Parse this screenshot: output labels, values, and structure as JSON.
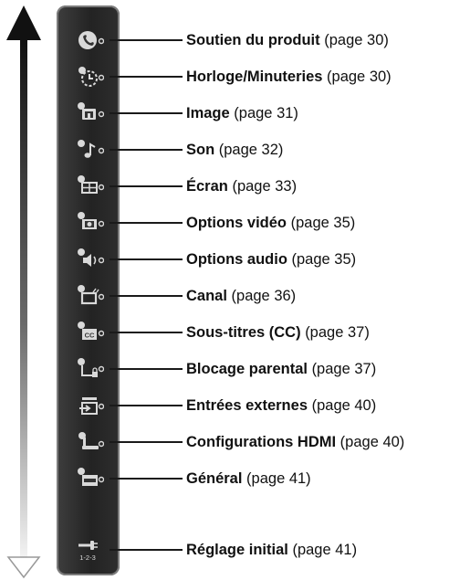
{
  "colors": {
    "bar": "#2b2b2b",
    "bar_border": "#7c7c7c",
    "icon": "#d9d9d9",
    "arrow_dark": "#111111"
  },
  "menu": {
    "items": [
      {
        "title": "Soutien du produit",
        "page": "(page 30)",
        "icon": "phone-icon"
      },
      {
        "title": "Horloge/Minuteries",
        "page": "(page 30)",
        "icon": "clock-timer-icon"
      },
      {
        "title": "Image",
        "page": "(page 31)",
        "icon": "picture-icon"
      },
      {
        "title": "Son",
        "page": "(page 32)",
        "icon": "sound-note-icon"
      },
      {
        "title": "Écran",
        "page": "(page 33)",
        "icon": "screen-icon"
      },
      {
        "title": "Options vidéo",
        "page": "(page 35)",
        "icon": "video-options-icon"
      },
      {
        "title": "Options audio",
        "page": "(page 35)",
        "icon": "audio-options-icon"
      },
      {
        "title": "Canal",
        "page": "(page 36)",
        "icon": "channel-tv-icon"
      },
      {
        "title": "Sous-titres (CC)",
        "page": "(page 37)",
        "icon": "closed-caption-icon"
      },
      {
        "title": "Blocage parental",
        "page": "(page 37)",
        "icon": "parental-lock-icon"
      },
      {
        "title": "Entrées externes",
        "page": "(page 40)",
        "icon": "external-inputs-icon"
      },
      {
        "title": "Configurations HDMI",
        "page": "(page 40)",
        "icon": "hdmi-settings-icon"
      },
      {
        "title": "Général",
        "page": "(page 41)",
        "icon": "general-settings-icon"
      },
      {
        "title": "Réglage initial",
        "page": "(page 41)",
        "icon": "initial-setup-icon",
        "icon_text": "1-2-3"
      }
    ]
  }
}
